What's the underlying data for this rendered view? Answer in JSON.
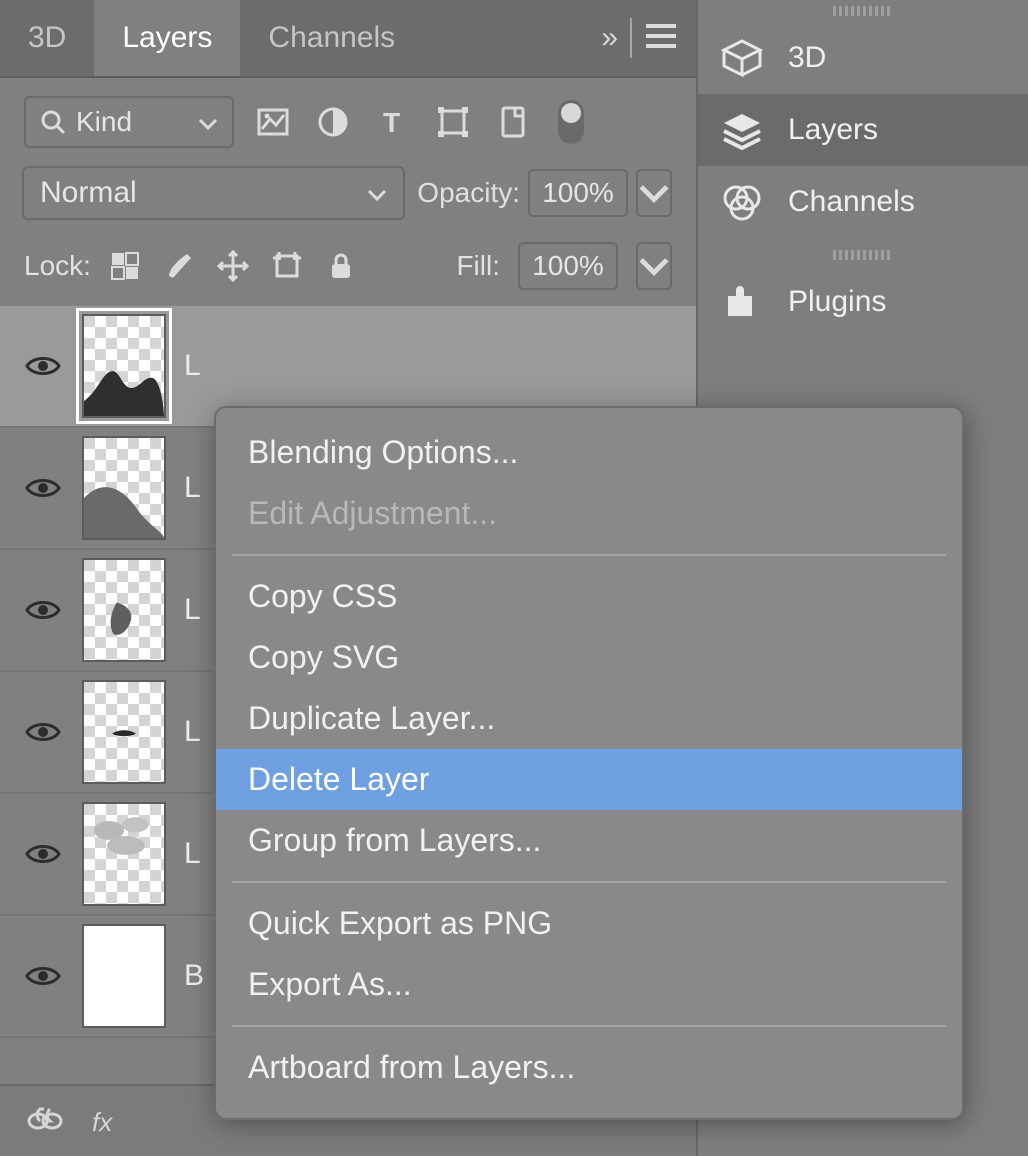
{
  "tabs": {
    "items": [
      "3D",
      "Layers",
      "Channels"
    ],
    "active_index": 1
  },
  "filter": {
    "kind_label": "Kind"
  },
  "blend": {
    "mode": "Normal",
    "opacity_label": "Opacity:",
    "opacity_value": "100%"
  },
  "lock": {
    "label": "Lock:",
    "fill_label": "Fill:",
    "fill_value": "100%"
  },
  "layers": [
    {
      "name": "L",
      "selected": true
    },
    {
      "name": "L",
      "selected": false
    },
    {
      "name": "L",
      "selected": false
    },
    {
      "name": "L",
      "selected": false
    },
    {
      "name": "L",
      "selected": false
    },
    {
      "name": "B",
      "selected": false,
      "white": true
    }
  ],
  "side_panels": [
    {
      "label": "3D",
      "icon": "cube"
    },
    {
      "label": "Layers",
      "icon": "layers",
      "active": true
    },
    {
      "label": "Channels",
      "icon": "channels"
    },
    {
      "label": "Plugins",
      "icon": "plugin"
    }
  ],
  "context_menu": {
    "items": [
      {
        "label": "Blending Options..."
      },
      {
        "label": "Edit Adjustment...",
        "disabled": true
      },
      {
        "sep": true
      },
      {
        "label": "Copy CSS"
      },
      {
        "label": "Copy SVG"
      },
      {
        "label": "Duplicate Layer..."
      },
      {
        "label": "Delete Layer",
        "highlight": true
      },
      {
        "label": "Group from Layers..."
      },
      {
        "sep": true
      },
      {
        "label": "Quick Export as PNG"
      },
      {
        "label": "Export As..."
      },
      {
        "sep": true
      },
      {
        "label": "Artboard from Layers..."
      }
    ]
  }
}
